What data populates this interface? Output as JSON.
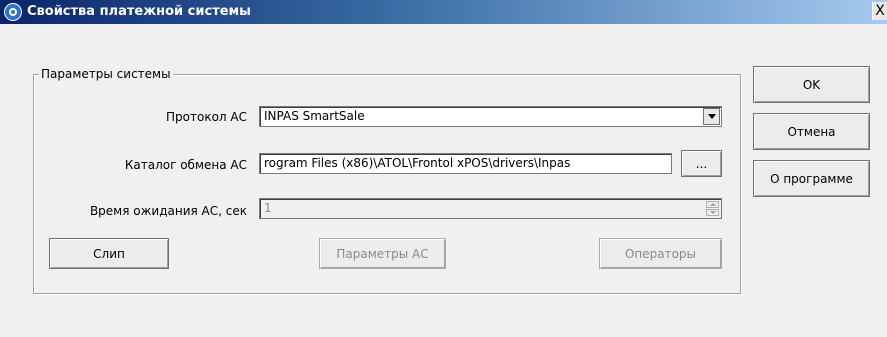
{
  "window": {
    "title": "Свойства платежной системы",
    "icon": "payment-system-icon",
    "close_glyph": "X"
  },
  "group": {
    "legend": "Параметры системы"
  },
  "fields": {
    "protocol_label": "Протокол АС",
    "protocol_value": "INPAS SmartSale",
    "catalog_label": "Каталог обмена АС",
    "catalog_value": "rogram Files (x86)\\ATOL\\Frontol xPOS\\drivers\\Inpas",
    "browse_label": "...",
    "timeout_label": "Время ожидания АС, сек",
    "timeout_value": "1"
  },
  "buttons": {
    "slip": "Слип",
    "ac_params": "Параметры АС",
    "operators": "Операторы",
    "ok": "OK",
    "cancel": "Отмена",
    "about": "О программе"
  }
}
